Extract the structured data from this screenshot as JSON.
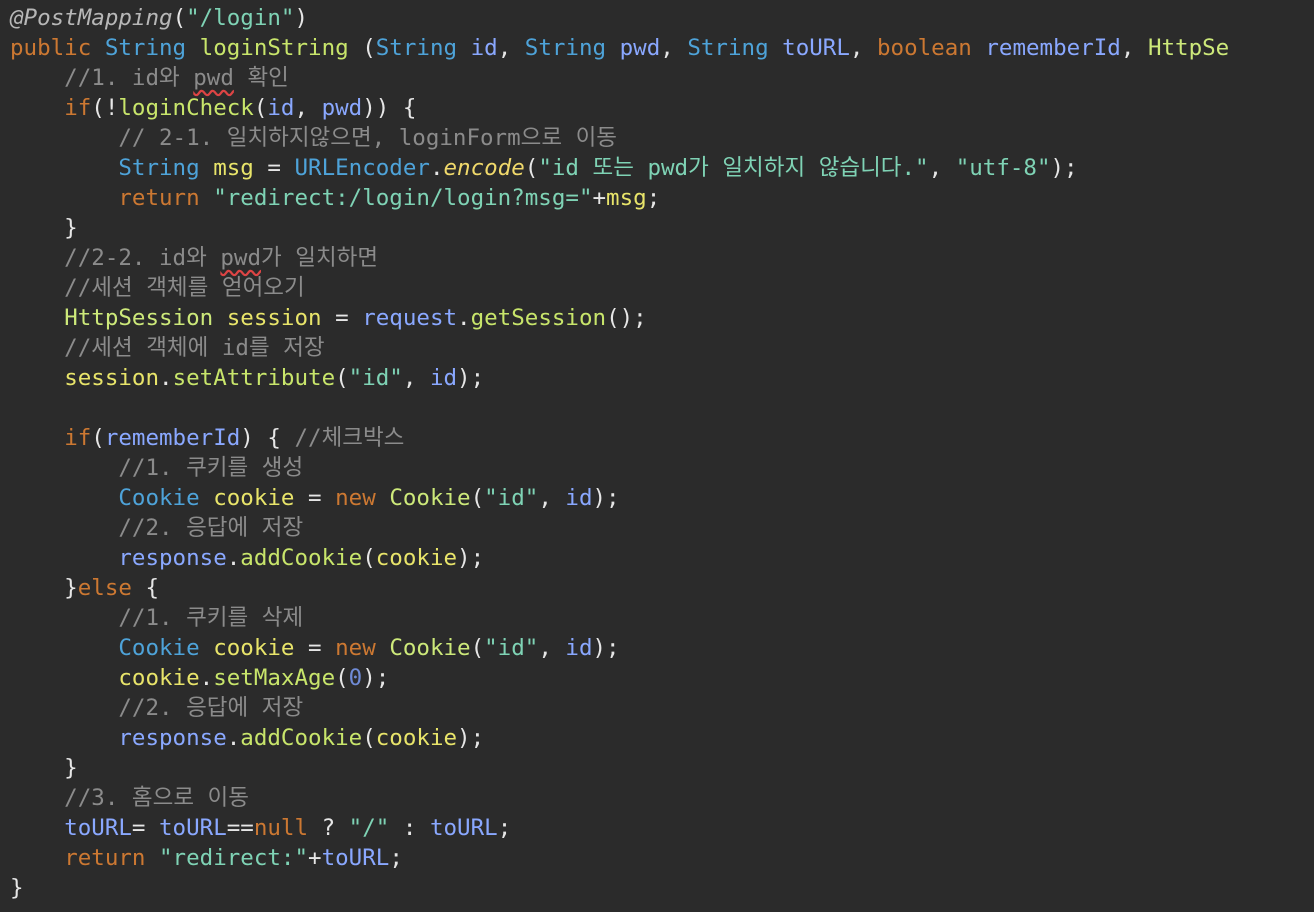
{
  "editor": {
    "background": "#2b2b2b",
    "lines": [
      {
        "tokens": [
          {
            "t": "@PostMapping",
            "k": "annotation"
          },
          {
            "t": "(",
            "k": "plain"
          },
          {
            "t": "\"/login\"",
            "k": "string"
          },
          {
            "t": ")",
            "k": "plain"
          }
        ]
      },
      {
        "tokens": [
          {
            "t": "public",
            "k": "keyword"
          },
          {
            "t": " ",
            "k": "plain"
          },
          {
            "t": "String",
            "k": "type"
          },
          {
            "t": " ",
            "k": "plain"
          },
          {
            "t": "loginString",
            "k": "method"
          },
          {
            "t": " (",
            "k": "plain"
          },
          {
            "t": "String",
            "k": "type"
          },
          {
            "t": " ",
            "k": "plain"
          },
          {
            "t": "id",
            "k": "param"
          },
          {
            "t": ", ",
            "k": "plain"
          },
          {
            "t": "String",
            "k": "type"
          },
          {
            "t": " ",
            "k": "plain"
          },
          {
            "t": "pwd",
            "k": "param"
          },
          {
            "t": ", ",
            "k": "plain"
          },
          {
            "t": "String",
            "k": "type"
          },
          {
            "t": " ",
            "k": "plain"
          },
          {
            "t": "toURL",
            "k": "param"
          },
          {
            "t": ", ",
            "k": "plain"
          },
          {
            "t": "boolean",
            "k": "keyword"
          },
          {
            "t": " ",
            "k": "plain"
          },
          {
            "t": "rememberId",
            "k": "param"
          },
          {
            "t": ", ",
            "k": "plain"
          },
          {
            "t": "HttpSe",
            "k": "class"
          }
        ]
      },
      {
        "tokens": [
          {
            "t": "    //1. id와 ",
            "k": "comment"
          },
          {
            "t": "pwd",
            "k": "typo"
          },
          {
            "t": " 확인",
            "k": "comment"
          }
        ]
      },
      {
        "tokens": [
          {
            "t": "    ",
            "k": "plain"
          },
          {
            "t": "if",
            "k": "keyword"
          },
          {
            "t": "(!",
            "k": "plain"
          },
          {
            "t": "loginCheck",
            "k": "method"
          },
          {
            "t": "(",
            "k": "plain"
          },
          {
            "t": "id",
            "k": "param"
          },
          {
            "t": ", ",
            "k": "plain"
          },
          {
            "t": "pwd",
            "k": "param"
          },
          {
            "t": ")) {",
            "k": "plain"
          }
        ]
      },
      {
        "tokens": [
          {
            "t": "        // 2-1. 일치하지않으면, loginForm으로 이동",
            "k": "comment"
          }
        ]
      },
      {
        "tokens": [
          {
            "t": "        ",
            "k": "plain"
          },
          {
            "t": "String",
            "k": "type"
          },
          {
            "t": " ",
            "k": "plain"
          },
          {
            "t": "msg",
            "k": "var"
          },
          {
            "t": " = ",
            "k": "plain"
          },
          {
            "t": "URLEncoder",
            "k": "type"
          },
          {
            "t": ".",
            "k": "plain"
          },
          {
            "t": "encode",
            "k": "static"
          },
          {
            "t": "(",
            "k": "plain"
          },
          {
            "t": "\"id 또는 pwd가 일치하지 않습니다.\"",
            "k": "string"
          },
          {
            "t": ", ",
            "k": "plain"
          },
          {
            "t": "\"utf-8\"",
            "k": "string"
          },
          {
            "t": ");",
            "k": "plain"
          }
        ]
      },
      {
        "tokens": [
          {
            "t": "        ",
            "k": "plain"
          },
          {
            "t": "return",
            "k": "keyword"
          },
          {
            "t": " ",
            "k": "plain"
          },
          {
            "t": "\"redirect:/login/login?msg=\"",
            "k": "string"
          },
          {
            "t": "+",
            "k": "plain"
          },
          {
            "t": "msg",
            "k": "var"
          },
          {
            "t": ";",
            "k": "plain"
          }
        ]
      },
      {
        "tokens": [
          {
            "t": "    }",
            "k": "plain"
          }
        ]
      },
      {
        "tokens": [
          {
            "t": "    //2-2. id와 ",
            "k": "comment"
          },
          {
            "t": "pwd",
            "k": "typo"
          },
          {
            "t": "가 일치하면",
            "k": "comment"
          }
        ]
      },
      {
        "tokens": [
          {
            "t": "    //세션 객체를 얻어오기",
            "k": "comment"
          }
        ]
      },
      {
        "tokens": [
          {
            "t": "    ",
            "k": "plain"
          },
          {
            "t": "HttpSession",
            "k": "class"
          },
          {
            "t": " ",
            "k": "plain"
          },
          {
            "t": "session",
            "k": "var"
          },
          {
            "t": " = ",
            "k": "plain"
          },
          {
            "t": "request",
            "k": "param"
          },
          {
            "t": ".",
            "k": "plain"
          },
          {
            "t": "getSession",
            "k": "method"
          },
          {
            "t": "();",
            "k": "plain"
          }
        ]
      },
      {
        "tokens": [
          {
            "t": "    //세션 객체에 id를 저장",
            "k": "comment"
          }
        ]
      },
      {
        "tokens": [
          {
            "t": "    ",
            "k": "plain"
          },
          {
            "t": "session",
            "k": "var"
          },
          {
            "t": ".",
            "k": "plain"
          },
          {
            "t": "setAttribute",
            "k": "method"
          },
          {
            "t": "(",
            "k": "plain"
          },
          {
            "t": "\"id\"",
            "k": "string"
          },
          {
            "t": ", ",
            "k": "plain"
          },
          {
            "t": "id",
            "k": "param"
          },
          {
            "t": ");",
            "k": "plain"
          }
        ]
      },
      {
        "tokens": [
          {
            "t": "",
            "k": "plain"
          }
        ]
      },
      {
        "tokens": [
          {
            "t": "    ",
            "k": "plain"
          },
          {
            "t": "if",
            "k": "keyword"
          },
          {
            "t": "(",
            "k": "plain"
          },
          {
            "t": "rememberId",
            "k": "param"
          },
          {
            "t": ") { ",
            "k": "plain"
          },
          {
            "t": "//체크박스",
            "k": "comment"
          }
        ]
      },
      {
        "tokens": [
          {
            "t": "        //1. 쿠키를 생성",
            "k": "comment"
          }
        ]
      },
      {
        "tokens": [
          {
            "t": "        ",
            "k": "plain"
          },
          {
            "t": "Cookie",
            "k": "type"
          },
          {
            "t": " ",
            "k": "plain"
          },
          {
            "t": "cookie",
            "k": "var"
          },
          {
            "t": " = ",
            "k": "plain"
          },
          {
            "t": "new",
            "k": "keyword"
          },
          {
            "t": " ",
            "k": "plain"
          },
          {
            "t": "Cookie",
            "k": "class"
          },
          {
            "t": "(",
            "k": "plain"
          },
          {
            "t": "\"id\"",
            "k": "string"
          },
          {
            "t": ", ",
            "k": "plain"
          },
          {
            "t": "id",
            "k": "param"
          },
          {
            "t": ");",
            "k": "plain"
          }
        ]
      },
      {
        "tokens": [
          {
            "t": "        //2. 응답에 저장",
            "k": "comment"
          }
        ]
      },
      {
        "tokens": [
          {
            "t": "        ",
            "k": "plain"
          },
          {
            "t": "response",
            "k": "param"
          },
          {
            "t": ".",
            "k": "plain"
          },
          {
            "t": "addCookie",
            "k": "method"
          },
          {
            "t": "(",
            "k": "plain"
          },
          {
            "t": "cookie",
            "k": "var"
          },
          {
            "t": ");",
            "k": "plain"
          }
        ]
      },
      {
        "tokens": [
          {
            "t": "    }",
            "k": "plain"
          },
          {
            "t": "else",
            "k": "keyword"
          },
          {
            "t": " {",
            "k": "plain"
          }
        ]
      },
      {
        "tokens": [
          {
            "t": "        //1. 쿠키를 삭제",
            "k": "comment"
          }
        ]
      },
      {
        "tokens": [
          {
            "t": "        ",
            "k": "plain"
          },
          {
            "t": "Cookie",
            "k": "type"
          },
          {
            "t": " ",
            "k": "plain"
          },
          {
            "t": "cookie",
            "k": "var"
          },
          {
            "t": " = ",
            "k": "plain"
          },
          {
            "t": "new",
            "k": "keyword"
          },
          {
            "t": " ",
            "k": "plain"
          },
          {
            "t": "Cookie",
            "k": "class"
          },
          {
            "t": "(",
            "k": "plain"
          },
          {
            "t": "\"id\"",
            "k": "string"
          },
          {
            "t": ", ",
            "k": "plain"
          },
          {
            "t": "id",
            "k": "param"
          },
          {
            "t": ");",
            "k": "plain"
          }
        ]
      },
      {
        "tokens": [
          {
            "t": "        ",
            "k": "plain"
          },
          {
            "t": "cookie",
            "k": "var"
          },
          {
            "t": ".",
            "k": "plain"
          },
          {
            "t": "setMaxAge",
            "k": "method"
          },
          {
            "t": "(",
            "k": "plain"
          },
          {
            "t": "0",
            "k": "number"
          },
          {
            "t": ");",
            "k": "plain"
          }
        ]
      },
      {
        "tokens": [
          {
            "t": "        //2. 응답에 저장",
            "k": "comment"
          }
        ]
      },
      {
        "tokens": [
          {
            "t": "        ",
            "k": "plain"
          },
          {
            "t": "response",
            "k": "param"
          },
          {
            "t": ".",
            "k": "plain"
          },
          {
            "t": "addCookie",
            "k": "method"
          },
          {
            "t": "(",
            "k": "plain"
          },
          {
            "t": "cookie",
            "k": "var"
          },
          {
            "t": ");",
            "k": "plain"
          }
        ]
      },
      {
        "tokens": [
          {
            "t": "    }",
            "k": "plain"
          }
        ]
      },
      {
        "tokens": [
          {
            "t": "    //3. 홈으로 이동",
            "k": "comment"
          }
        ]
      },
      {
        "tokens": [
          {
            "t": "    ",
            "k": "plain"
          },
          {
            "t": "toURL",
            "k": "param"
          },
          {
            "t": "= ",
            "k": "plain"
          },
          {
            "t": "toURL",
            "k": "param"
          },
          {
            "t": "==",
            "k": "plain"
          },
          {
            "t": "null",
            "k": "keyword"
          },
          {
            "t": " ? ",
            "k": "plain"
          },
          {
            "t": "\"/\"",
            "k": "string"
          },
          {
            "t": " : ",
            "k": "plain"
          },
          {
            "t": "toURL",
            "k": "param"
          },
          {
            "t": ";",
            "k": "plain"
          }
        ]
      },
      {
        "tokens": [
          {
            "t": "    ",
            "k": "plain"
          },
          {
            "t": "return",
            "k": "keyword"
          },
          {
            "t": " ",
            "k": "plain"
          },
          {
            "t": "\"redirect:\"",
            "k": "string"
          },
          {
            "t": "+",
            "k": "plain"
          },
          {
            "t": "toURL",
            "k": "param"
          },
          {
            "t": ";",
            "k": "plain"
          }
        ]
      },
      {
        "tokens": [
          {
            "t": "}",
            "k": "plain"
          }
        ]
      }
    ]
  }
}
